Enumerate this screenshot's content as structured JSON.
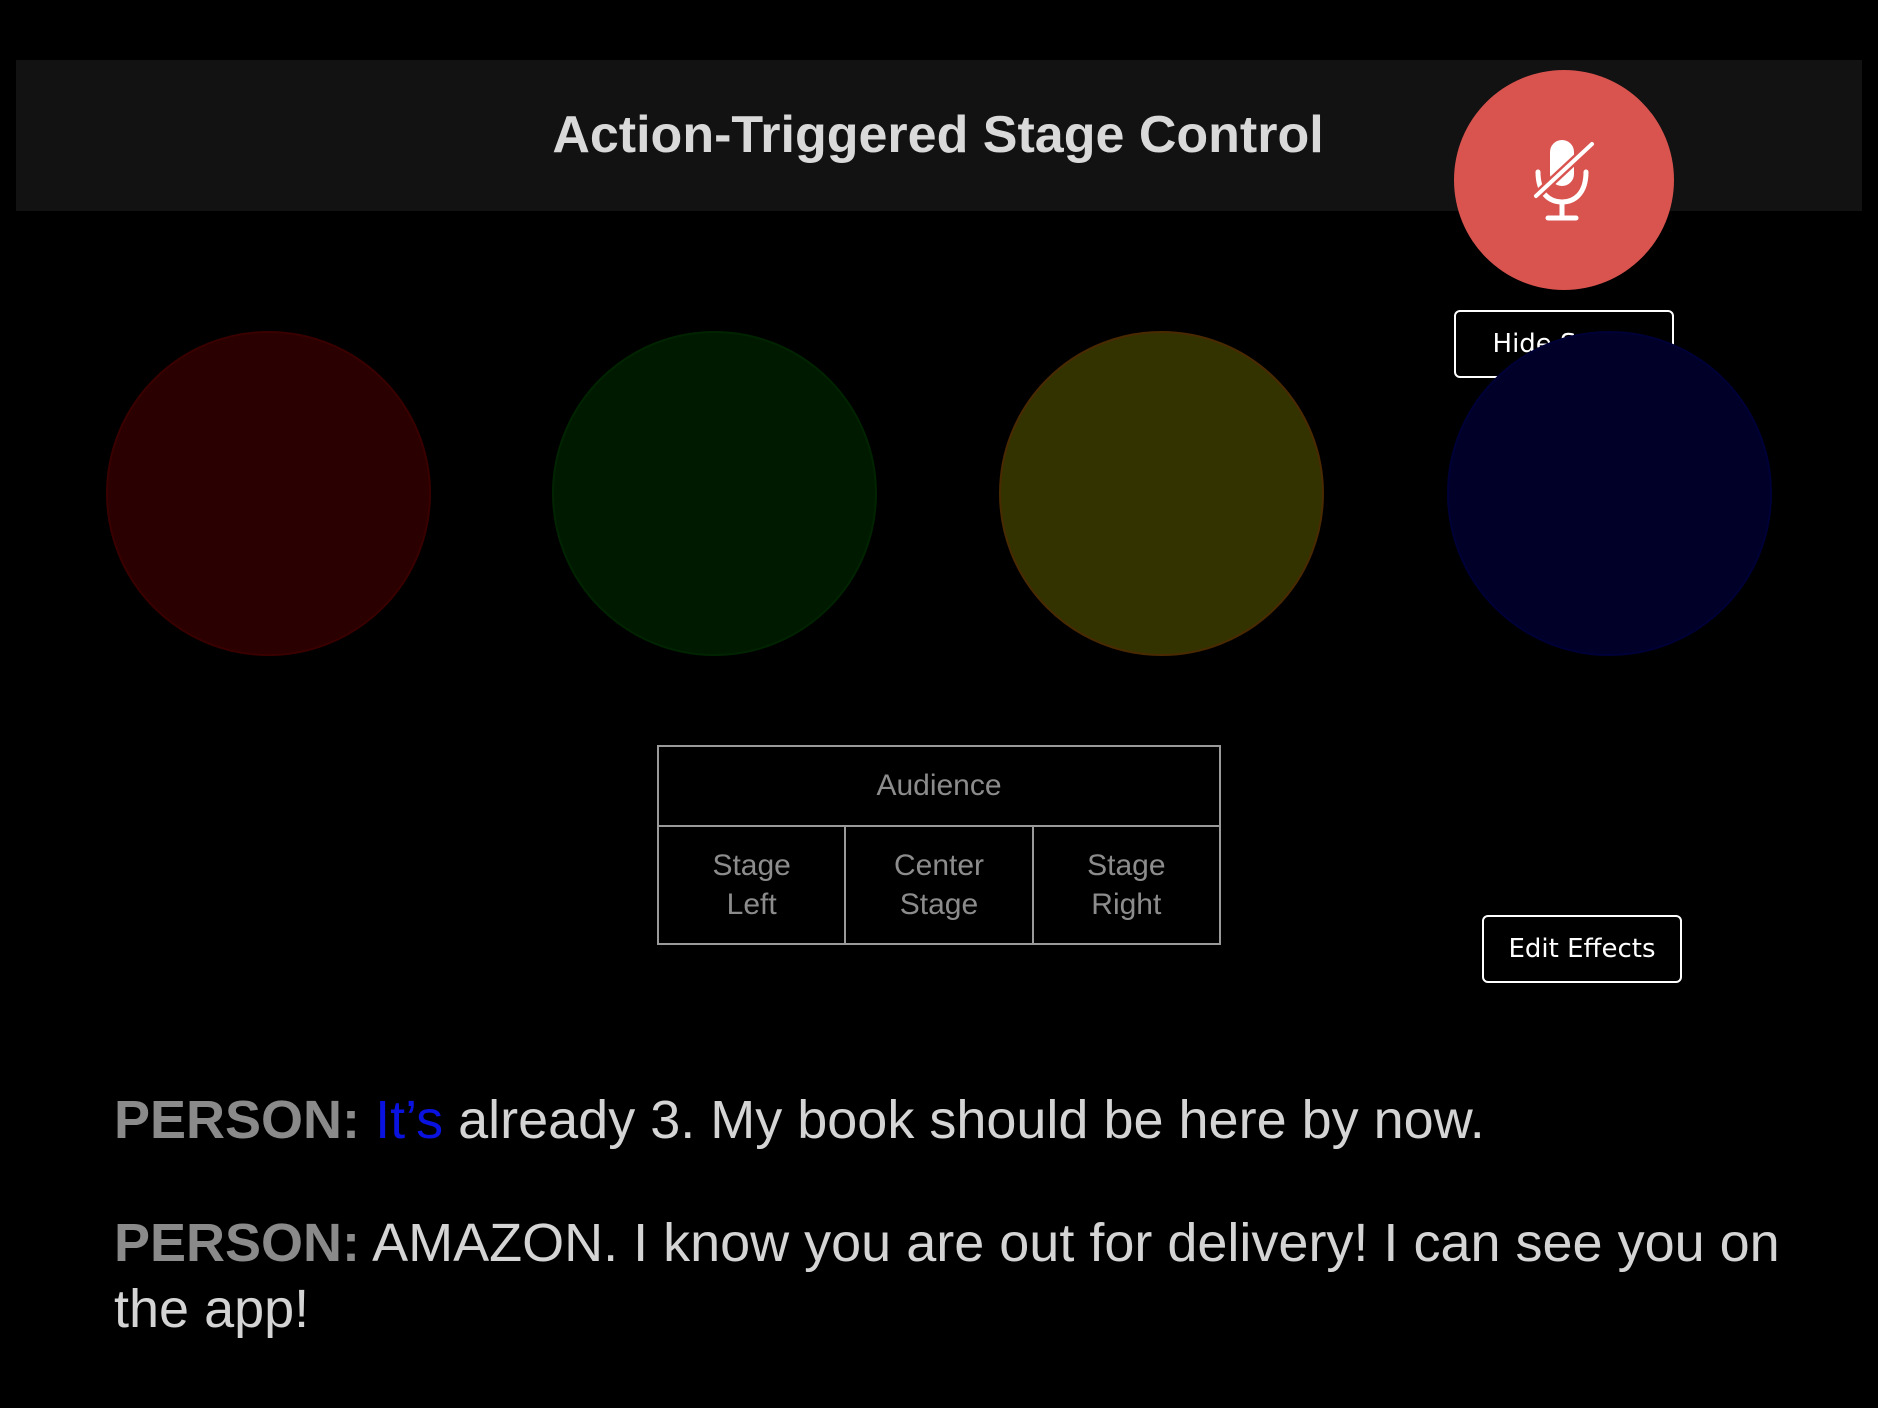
{
  "header": {
    "title": "Action-Triggered Stage Control"
  },
  "mic": {
    "icon": "microphone-off-icon",
    "state": "muted",
    "color": "#d9534f"
  },
  "buttons": {
    "hide_script": "Hide Script",
    "edit_effects": "Edit Effects"
  },
  "lights": [
    {
      "name": "red",
      "fill": "#2a0000",
      "border": "#3a0000"
    },
    {
      "name": "green",
      "fill": "#001a00",
      "border": "#002400"
    },
    {
      "name": "yellow",
      "fill": "#333300",
      "border": "#4a2a00"
    },
    {
      "name": "blue",
      "fill": "#000028",
      "border": "#000038"
    }
  ],
  "stage_map": {
    "audience": "Audience",
    "zones": [
      {
        "line1": "Stage",
        "line2": "Left"
      },
      {
        "line1": "Center",
        "line2": "Stage"
      },
      {
        "line1": "Stage",
        "line2": "Right"
      }
    ]
  },
  "script": [
    {
      "speaker": "PERSON:",
      "highlight": "It’s",
      "text": " already 3. My book should be here by now."
    },
    {
      "speaker": "PERSON:",
      "highlight": "",
      "text": " AMAZON. I know you are out for delivery! I can see you on the app!"
    }
  ]
}
